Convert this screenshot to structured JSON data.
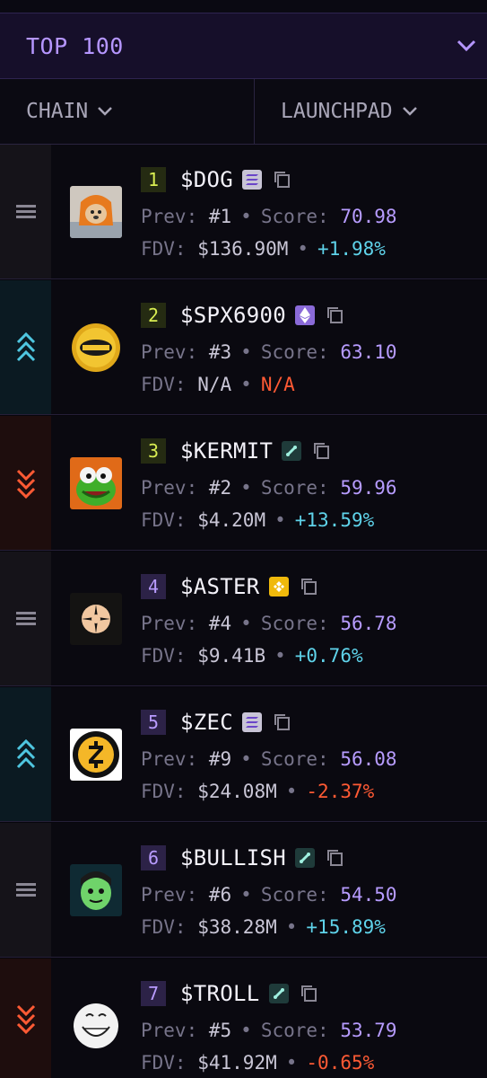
{
  "header": {
    "top_select": "TOP 100",
    "chain_filter": "CHAIN",
    "launchpad_filter": "LAUNCHPAD"
  },
  "labels": {
    "prev": "Prev:",
    "score": "Score:",
    "fdv": "FDV:",
    "sep": "•"
  },
  "colors": {
    "accent": "#b596ff",
    "positive": "#5fd3ea",
    "negative": "#ff5a34",
    "rank_gold": "#d9ee52"
  },
  "rows": [
    {
      "rank": "1",
      "ticker": "$DOG",
      "chain_icon": "solana-icon",
      "prev": "#1",
      "score": "70.98",
      "fdv": "$136.90M",
      "change": "+1.98%",
      "trend": "same"
    },
    {
      "rank": "2",
      "ticker": "$SPX6900",
      "chain_icon": "ethereum-icon",
      "prev": "#3",
      "score": "63.10",
      "fdv": "N/A",
      "change": "N/A",
      "trend": "up"
    },
    {
      "rank": "3",
      "ticker": "$KERMIT",
      "chain_icon": "hyperliquid-icon",
      "prev": "#2",
      "score": "59.96",
      "fdv": "$4.20M",
      "change": "+13.59%",
      "trend": "down"
    },
    {
      "rank": "4",
      "ticker": "$ASTER",
      "chain_icon": "bnb-icon",
      "prev": "#4",
      "score": "56.78",
      "fdv": "$9.41B",
      "change": "+0.76%",
      "trend": "same"
    },
    {
      "rank": "5",
      "ticker": "$ZEC",
      "chain_icon": "solana-icon",
      "prev": "#9",
      "score": "56.08",
      "fdv": "$24.08M",
      "change": "-2.37%",
      "trend": "up"
    },
    {
      "rank": "6",
      "ticker": "$BULLISH",
      "chain_icon": "hyperliquid-icon",
      "prev": "#6",
      "score": "54.50",
      "fdv": "$38.28M",
      "change": "+15.89%",
      "trend": "same"
    },
    {
      "rank": "7",
      "ticker": "$TROLL",
      "chain_icon": "hyperliquid-icon",
      "prev": "#5",
      "score": "53.79",
      "fdv": "$41.92M",
      "change": "-0.65%",
      "trend": "down"
    }
  ]
}
